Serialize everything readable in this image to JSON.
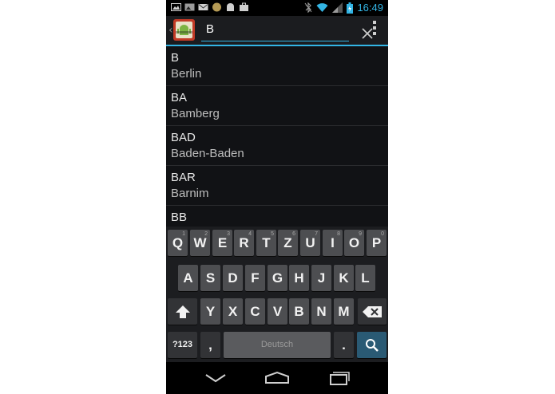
{
  "status_bar": {
    "time": "16:49",
    "icons": [
      "picture-icon",
      "image-icon",
      "mail-icon",
      "cookie-icon",
      "android-icon",
      "briefcase-icon"
    ],
    "right_icons": [
      "bluetooth-off-icon",
      "wifi-icon",
      "signal-icon",
      "battery-icon"
    ]
  },
  "action_bar": {
    "app_icon": "car-plate-app-icon",
    "search_value": "B",
    "clear_icon": "close-icon",
    "overflow_icon": "overflow-menu-icon"
  },
  "results": [
    {
      "code": "B",
      "name": "Berlin"
    },
    {
      "code": "BA",
      "name": "Bamberg"
    },
    {
      "code": "BAD",
      "name": "Baden-Baden"
    },
    {
      "code": "BAR",
      "name": "Barnim"
    },
    {
      "code": "BB",
      "name": ""
    }
  ],
  "keyboard": {
    "row1": [
      {
        "key": "Q",
        "hint": "1"
      },
      {
        "key": "W",
        "hint": "2"
      },
      {
        "key": "E",
        "hint": "3"
      },
      {
        "key": "R",
        "hint": "4"
      },
      {
        "key": "T",
        "hint": "5"
      },
      {
        "key": "Z",
        "hint": "6"
      },
      {
        "key": "U",
        "hint": "7"
      },
      {
        "key": "I",
        "hint": "8"
      },
      {
        "key": "O",
        "hint": "9"
      },
      {
        "key": "P",
        "hint": "0"
      }
    ],
    "row2": [
      "A",
      "S",
      "D",
      "F",
      "G",
      "H",
      "J",
      "K",
      "L"
    ],
    "row3": [
      "Y",
      "X",
      "C",
      "V",
      "B",
      "N",
      "M"
    ],
    "symbols_label": "?123",
    "comma_label": ",",
    "space_label": "Deutsch",
    "period_label": ".",
    "colors": {
      "accent": "#33b5e5",
      "key": "#4d4e51",
      "search_key": "#2a5a74"
    }
  },
  "nav_bar": {
    "back_icon": "back-icon",
    "home_icon": "home-icon",
    "recents_icon": "recent-apps-icon"
  }
}
